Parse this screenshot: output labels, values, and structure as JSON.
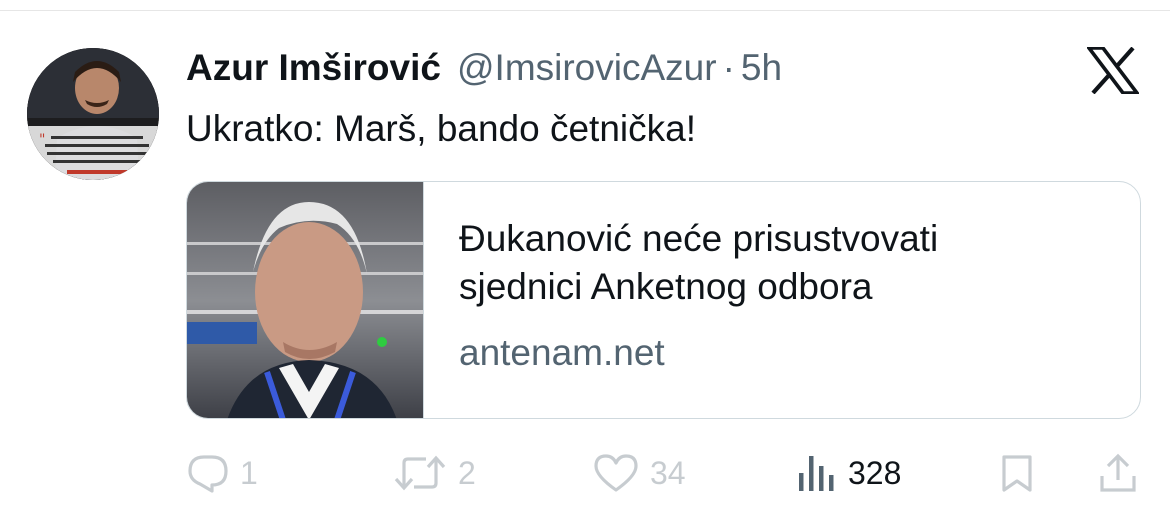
{
  "tweet": {
    "author_name": "Azur Imširović",
    "handle": "@ImsirovicAzur",
    "separator": "·",
    "time": "5h",
    "text": "Ukratko: Marš, bando četnička!",
    "avatar_icon": "avatar-photo",
    "platform_icon": "x-logo-icon"
  },
  "card": {
    "title_line1": "Đukanović neće prisustvovati",
    "title_line2": "sjednici Anketnog odbora",
    "domain": "antenam.net",
    "thumbnail": "news-photo-thumbnail"
  },
  "actions": {
    "reply_count": "1",
    "retweet_count": "2",
    "like_count": "34",
    "views_count": "328"
  },
  "colors": {
    "text": "#0f1419",
    "secondary": "#536471",
    "border": "#cfd9de"
  }
}
